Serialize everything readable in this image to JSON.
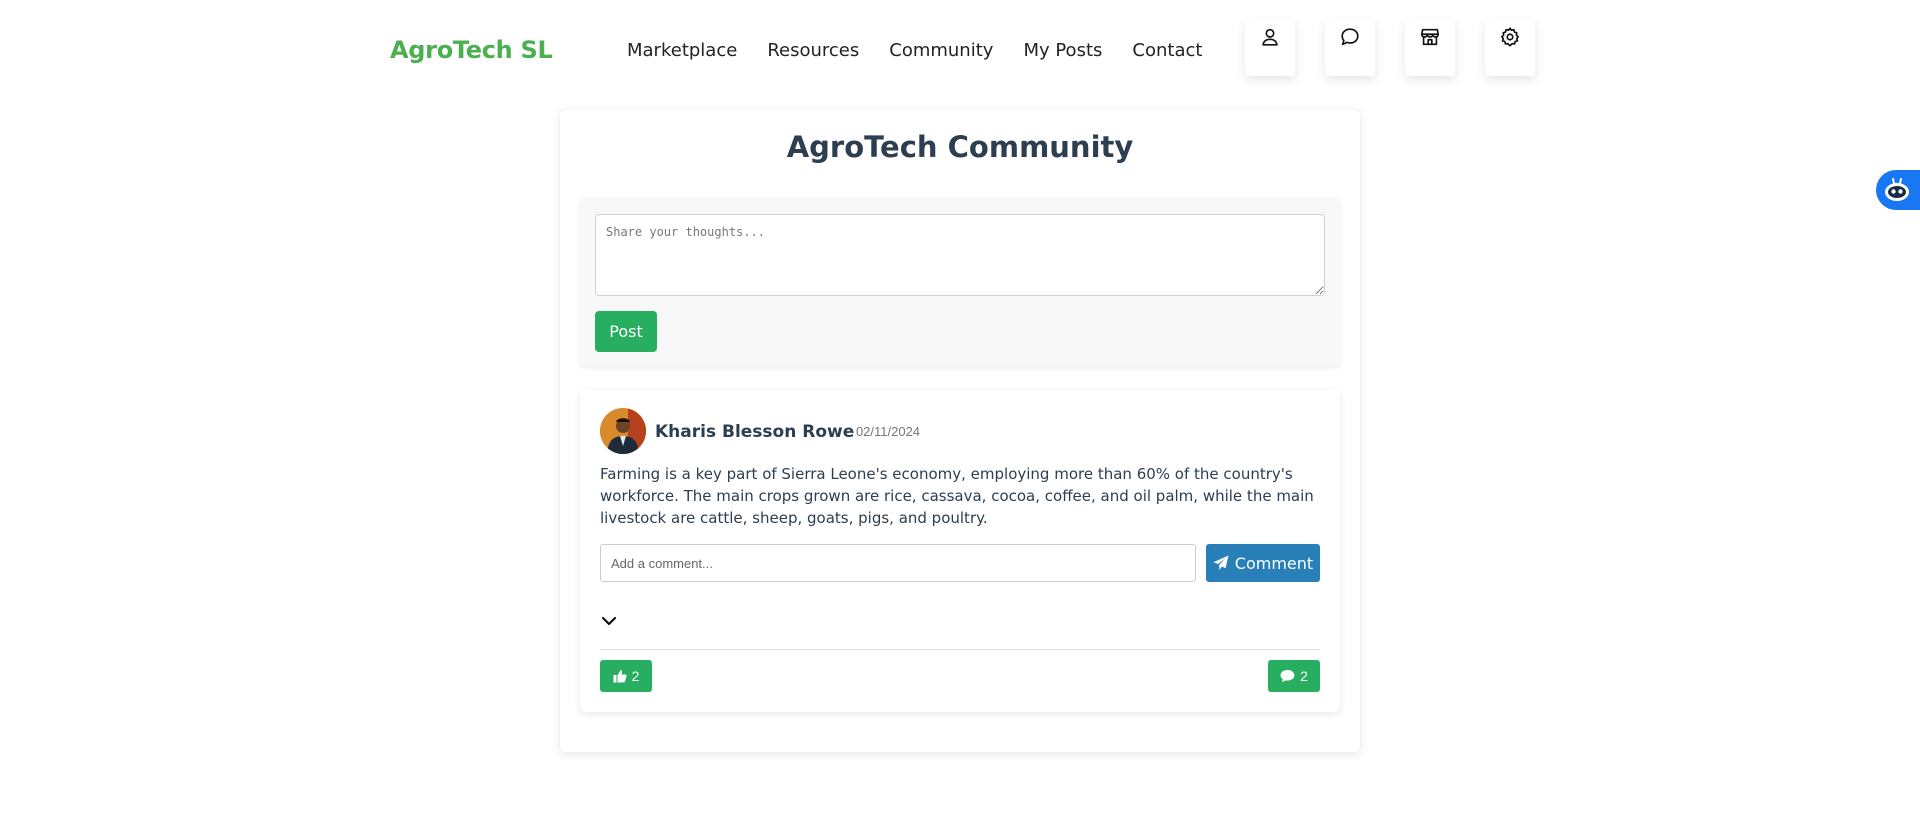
{
  "header": {
    "brand": "AgroTech SL",
    "nav": [
      "Marketplace",
      "Resources",
      "Community",
      "My Posts",
      "Contact"
    ],
    "icons": [
      "user-icon",
      "chat-icon",
      "store-icon",
      "gear-icon"
    ]
  },
  "main": {
    "title": "AgroTech Community",
    "composer": {
      "placeholder": "Share your thoughts...",
      "post_label": "Post"
    },
    "post": {
      "author": "Kharis Blesson Rowe",
      "date": "- 02/11/2024",
      "body": "Farming is a key part of Sierra Leone's economy, employing more than 60% of the country's workforce. The main crops grown are rice, cassava, cocoa, coffee, and oil palm, while the main livestock are cattle, sheep, goats, pigs, and poultry.",
      "comment_placeholder": "Add a comment...",
      "comment_label": "Comment",
      "likes": "2",
      "comments": "2"
    }
  },
  "colors": {
    "brand": "#4caf50",
    "primary_green": "#27ae60",
    "comment_blue": "#2980b9",
    "bot_blue": "#1877f2"
  }
}
